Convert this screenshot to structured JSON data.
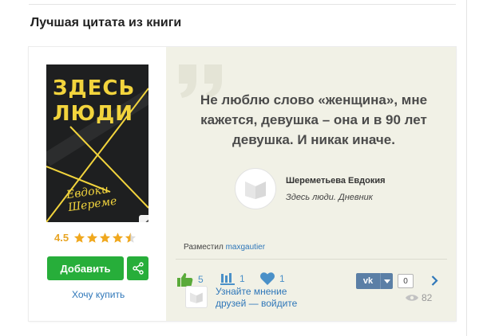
{
  "section": {
    "title": "Лучшая цитата из книги"
  },
  "book": {
    "cover_title_line1": "ЗДЕСЬ",
    "cover_title_line2": "ЛЮДИ",
    "cover_author_line1": "Евдоки",
    "cover_author_line2": "Шереме",
    "rating": "4.5",
    "rating_stars": 4.5,
    "add_label": "Добавить",
    "buy_label": "Хочу купить"
  },
  "quote": {
    "text": "Не люблю слово «женщина», мне кажется, девушка – она и в 90 лет девушка. И никак иначе.",
    "author_name": "Шереметьева Евдокия",
    "book_title": "Здесь люди. Дневник",
    "posted_prefix": "Разместил",
    "posted_user": "maxgautier"
  },
  "actions": {
    "likes": "5",
    "shelves": "1",
    "hearts": "1",
    "invite_text": "Узнайте мнение друзей — войдите",
    "vk_label": "vk",
    "vk_count": "0",
    "views": "82"
  },
  "colors": {
    "accent_green": "#27ae3a",
    "link_blue": "#2f77b9",
    "star": "#f0a81e",
    "panel_bg": "#f1f1e6"
  }
}
